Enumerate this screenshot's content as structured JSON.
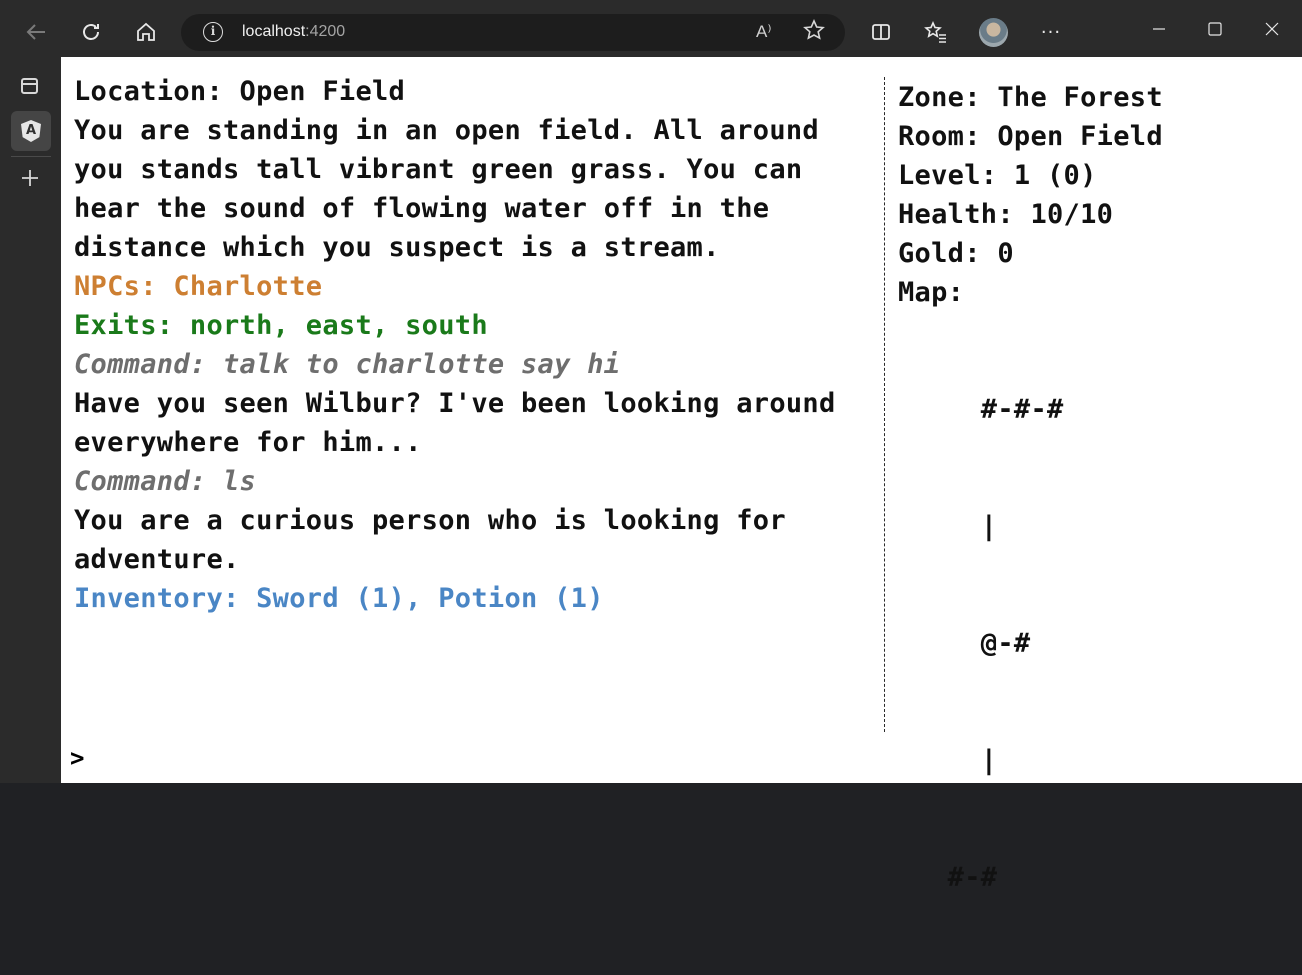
{
  "browser": {
    "url_host": "localhost",
    "url_port": ":4200",
    "read_aloud_glyph": "A⁾",
    "icons": [
      "back-icon",
      "refresh-icon",
      "home-icon",
      "info-icon",
      "read-aloud-icon",
      "favorite-star-icon",
      "split-screen-icon",
      "favorites-icon",
      "profile-avatar",
      "more-icon"
    ],
    "more_glyph": "···"
  },
  "game": {
    "location": "Location: Open Field",
    "description": "You are standing in an open field. All around you stands tall vibrant green grass. You can hear the sound of flowing water off in the distance which you suspect is a stream.",
    "npcs": "NPCs: Charlotte",
    "exits": "Exits: north, east, south",
    "command1": "Command: talk to charlotte say hi",
    "response1": "Have you seen Wilbur? I've been looking around everywhere for him...",
    "command2": "Command: ls",
    "response2": "You are a curious person who is looking for adventure.",
    "inventory": "Inventory: Sword (1), Potion (1)",
    "prompt": ">"
  },
  "status": {
    "zone": "Zone: The Forest",
    "room": "Room: Open Field",
    "level": "Level: 1 (0)",
    "health": "Health: 10/10",
    "gold": "Gold: 0",
    "map_label": "Map:",
    "map_lines": [
      "     #-#-#",
      "     |",
      "     @-#",
      "     |",
      "   #-#"
    ]
  },
  "colors": {
    "npc": "#cd7f32",
    "exits": "#1a7a1a",
    "command": "#6e6e6e",
    "inventory": "#4a86c5"
  }
}
